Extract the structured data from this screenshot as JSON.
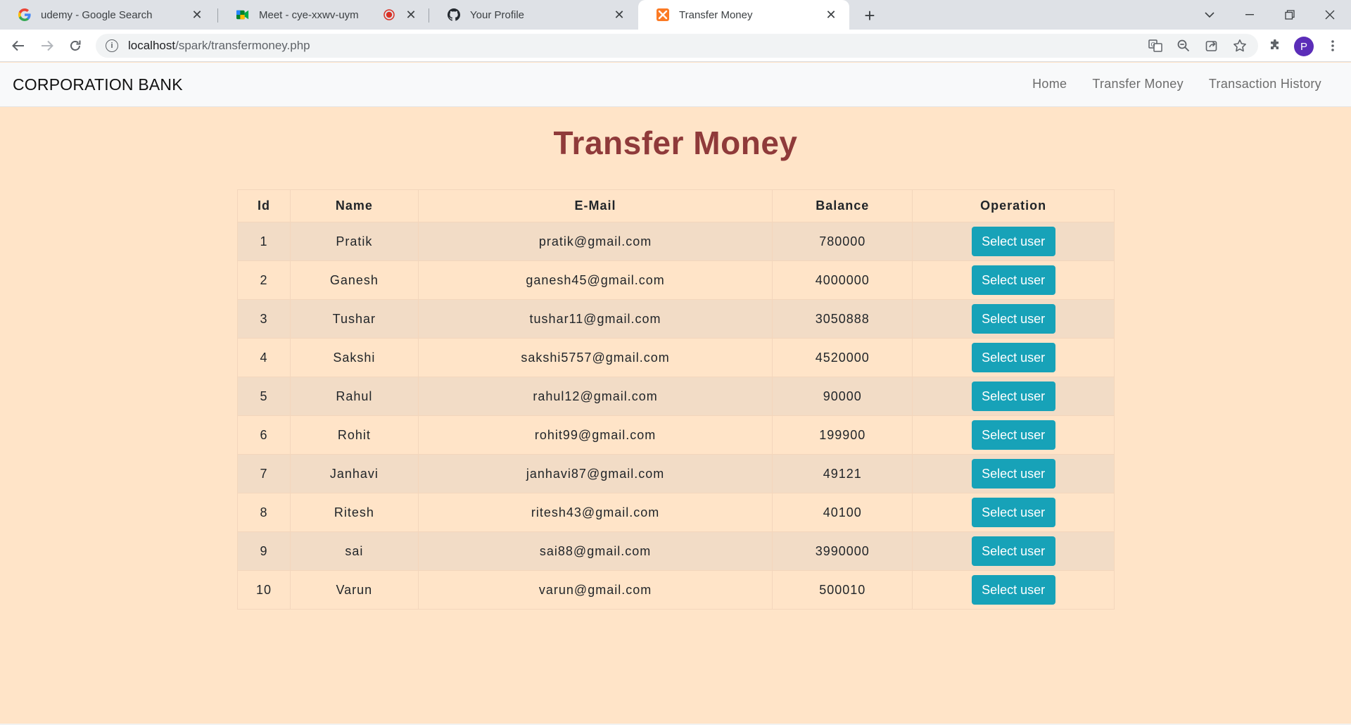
{
  "browser": {
    "tabs": [
      {
        "title": "udemy - Google Search",
        "icon": "google-icon"
      },
      {
        "title": "Meet - cye-xxwv-uym",
        "icon": "meet-icon",
        "recording": true
      },
      {
        "title": "Your Profile",
        "icon": "github-icon"
      },
      {
        "title": "Transfer Money",
        "icon": "xampp-icon",
        "active": true
      }
    ],
    "url_host": "localhost",
    "url_path": "/spark/transfermoney.php",
    "profile_initial": "P"
  },
  "site": {
    "brand": "CORPORATION BANK",
    "nav": [
      "Home",
      "Transfer Money",
      "Transaction History"
    ]
  },
  "page": {
    "title": "Transfer Money",
    "columns": [
      "Id",
      "Name",
      "E-Mail",
      "Balance",
      "Operation"
    ],
    "button_label": "Select user",
    "rows": [
      {
        "id": "1",
        "name": "Pratik",
        "email": "pratik@gmail.com",
        "balance": "780000"
      },
      {
        "id": "2",
        "name": "Ganesh",
        "email": "ganesh45@gmail.com",
        "balance": "4000000"
      },
      {
        "id": "3",
        "name": "Tushar",
        "email": "tushar11@gmail.com",
        "balance": "3050888"
      },
      {
        "id": "4",
        "name": "Sakshi",
        "email": "sakshi5757@gmail.com",
        "balance": "4520000"
      },
      {
        "id": "5",
        "name": "Rahul",
        "email": "rahul12@gmail.com",
        "balance": "90000"
      },
      {
        "id": "6",
        "name": "Rohit",
        "email": "rohit99@gmail.com",
        "balance": "199900"
      },
      {
        "id": "7",
        "name": "Janhavi",
        "email": "janhavi87@gmail.com",
        "balance": "49121"
      },
      {
        "id": "8",
        "name": "Ritesh",
        "email": "ritesh43@gmail.com",
        "balance": "40100"
      },
      {
        "id": "9",
        "name": "sai",
        "email": "sai88@gmail.com",
        "balance": "3990000"
      },
      {
        "id": "10",
        "name": "Varun",
        "email": "varun@gmail.com",
        "balance": "500010"
      }
    ]
  },
  "colors": {
    "page_bg": "#ffe4c8",
    "title": "#8f3a3a",
    "button": "#17a2b8",
    "stripe": "#f2dcc6"
  }
}
